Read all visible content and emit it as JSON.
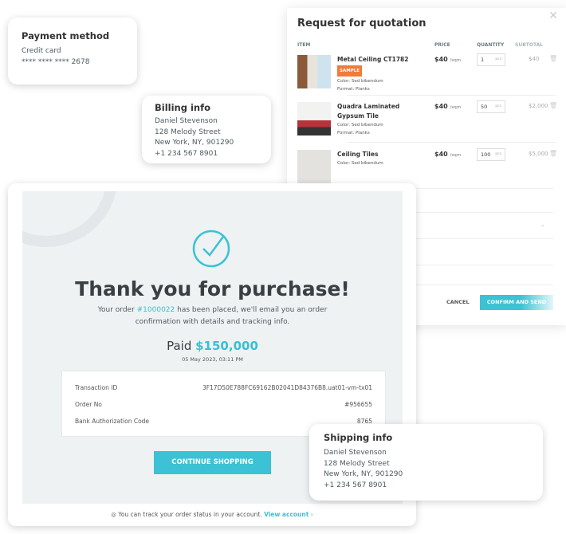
{
  "payment": {
    "title": "Payment method",
    "method": "Credit card",
    "card": "**** **** **** 2678"
  },
  "billing": {
    "title": "Billing info",
    "lines": [
      "Daniel Stevenson",
      "128 Melody Street",
      "New York, NY, 901290",
      "+1 234 567 8901"
    ]
  },
  "quote": {
    "title": "Request for quotation",
    "headers": {
      "item": "ITEM",
      "price": "PRICE",
      "quantity": "QUANTITY",
      "subtotal": "SUBTOTAL"
    },
    "items": [
      {
        "name": "Metal Ceiling CT1782",
        "badge": "SAMPLE",
        "color": "Color:  Sed bibendum",
        "format": "Format:  Planks",
        "price": "$40",
        "unit": "/sqm",
        "qty": "1",
        "qty_unit": "pcs",
        "subtotal": "$40"
      },
      {
        "name": "Quadra Laminated Gypsum Tile",
        "color": "Color:  Sed bibendum",
        "format": "Format:  Planks",
        "price": "$40",
        "unit": "/sqm",
        "qty": "50",
        "qty_unit": "pcs",
        "subtotal": "$2,000"
      },
      {
        "name": "Ceiling Tiles",
        "color": "Color:  Sed bibendum",
        "price": "$40",
        "unit": "/sqm",
        "qty": "100",
        "qty_unit": "pcs",
        "subtotal": "$5,000"
      }
    ],
    "cancel": "CANCEL",
    "confirm": "CONFIRM AND SEND"
  },
  "order": {
    "title": "Thank you for purchase!",
    "msg_pre": "Your order ",
    "order_link": "#1000022",
    "msg_post": " has been placed, we'll email you an order",
    "msg_line2": "confirmation with details and tracking info.",
    "paid_label": "Paid ",
    "paid_amount": "$150,000",
    "date": "05 May 2023, 03:11 PM",
    "details": [
      {
        "label": "Transaction ID",
        "value": "3F17D50E788FC69162B02041D84376B8.uat01-vm-tx01"
      },
      {
        "label": "Order No",
        "value": "#956655"
      },
      {
        "label": "Bank Authorization Code",
        "value": "8765"
      }
    ],
    "continue": "CONTINUE SHOPPING",
    "footer_text": "You can track your order status in your account.",
    "footer_link": "View account",
    "accent": "#3bc2d4"
  },
  "shipping": {
    "title": "Shipping info",
    "lines": [
      "Daniel Stevenson",
      "128 Melody Street",
      "New York, NY, 901290",
      "+1 234 567 8901"
    ]
  }
}
